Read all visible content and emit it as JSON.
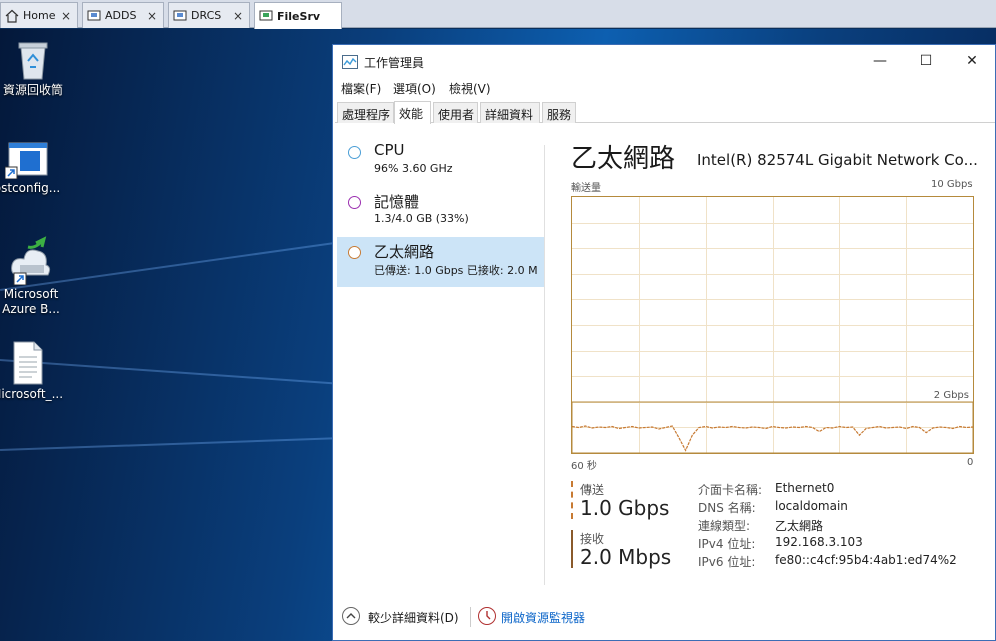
{
  "vm_tabs": [
    {
      "label": "Home",
      "icon": "home-icon"
    },
    {
      "label": "ADDS",
      "icon": "vm-icon"
    },
    {
      "label": "DRCS",
      "icon": "vm-icon"
    },
    {
      "label": "FileSrv",
      "icon": "vm-icon",
      "active": true
    }
  ],
  "vm_tab_close": "×",
  "desktop_icons": [
    {
      "label": "資源回收筒",
      "icon": "recycle-bin-icon"
    },
    {
      "label": "ostconfig...",
      "icon": "app-window-icon"
    },
    {
      "label": "Microsoft",
      "label2": "Azure B...",
      "icon": "azure-backup-icon"
    },
    {
      "label": "Microsoft_...",
      "icon": "document-icon"
    }
  ],
  "window": {
    "title": "工作管理員",
    "minimize": "—",
    "maximize": "☐",
    "close": "✕"
  },
  "menu": [
    "檔案(F)",
    "選項(O)",
    "檢視(V)"
  ],
  "tabs": [
    "處理程序",
    "效能",
    "使用者",
    "詳細資料",
    "服務"
  ],
  "active_tab": "效能",
  "resources": [
    {
      "name": "CPU",
      "detail": "96%  3.60 GHz",
      "color": "#4a9ed6"
    },
    {
      "name": "記憶體",
      "detail": "1.3/4.0 GB (33%)",
      "color": "#9b2fb0"
    },
    {
      "name": "乙太網路",
      "detail": "已傳送: 1.0 Gbps 已接收: 2.0 M",
      "color": "#c77a33",
      "active": true
    }
  ],
  "detail": {
    "title": "乙太網路",
    "adapter": "Intel(R) 82574L Gigabit Network Co...",
    "throughput_label": "輸送量",
    "max_label": "10 Gbps",
    "scale_label": "2 Gbps",
    "time_left": "60 秒",
    "time_right": "0",
    "send_label": "傳送",
    "send_value": "1.0 Gbps",
    "recv_label": "接收",
    "recv_value": "2.0 Mbps",
    "properties": [
      {
        "key": "介面卡名稱:",
        "value": "Ethernet0"
      },
      {
        "key": "DNS 名稱:",
        "value": "localdomain"
      },
      {
        "key": "連線類型:",
        "value": "乙太網路"
      },
      {
        "key": "IPv4 位址:",
        "value": "192.168.3.103"
      },
      {
        "key": "IPv6 位址:",
        "value": "fe80::c4cf:95b4:4ab1:ed74%2"
      }
    ],
    "graph_color": "#c77a33",
    "send_series_fraction": [
      0.52,
      0.5,
      0.53,
      0.49,
      0.51,
      0.5,
      0.52,
      0.48,
      0.5,
      0.52,
      0.49,
      0.5,
      0.51,
      0.47,
      0.5,
      0.53,
      0.3,
      0.05,
      0.35,
      0.5,
      0.52,
      0.49,
      0.51,
      0.5,
      0.52,
      0.5,
      0.49,
      0.51,
      0.5,
      0.48,
      0.52,
      0.5,
      0.49,
      0.51,
      0.5,
      0.52,
      0.5,
      0.42,
      0.5,
      0.49,
      0.52,
      0.5,
      0.51,
      0.35,
      0.48,
      0.5,
      0.52,
      0.49,
      0.5,
      0.51,
      0.48,
      0.52,
      0.5,
      0.4,
      0.49,
      0.51,
      0.5,
      0.48,
      0.52,
      0.5,
      0.51
    ]
  },
  "footer": {
    "fewer_details": "較少詳細資料(D)",
    "open_resmon": "開啟資源監視器"
  }
}
